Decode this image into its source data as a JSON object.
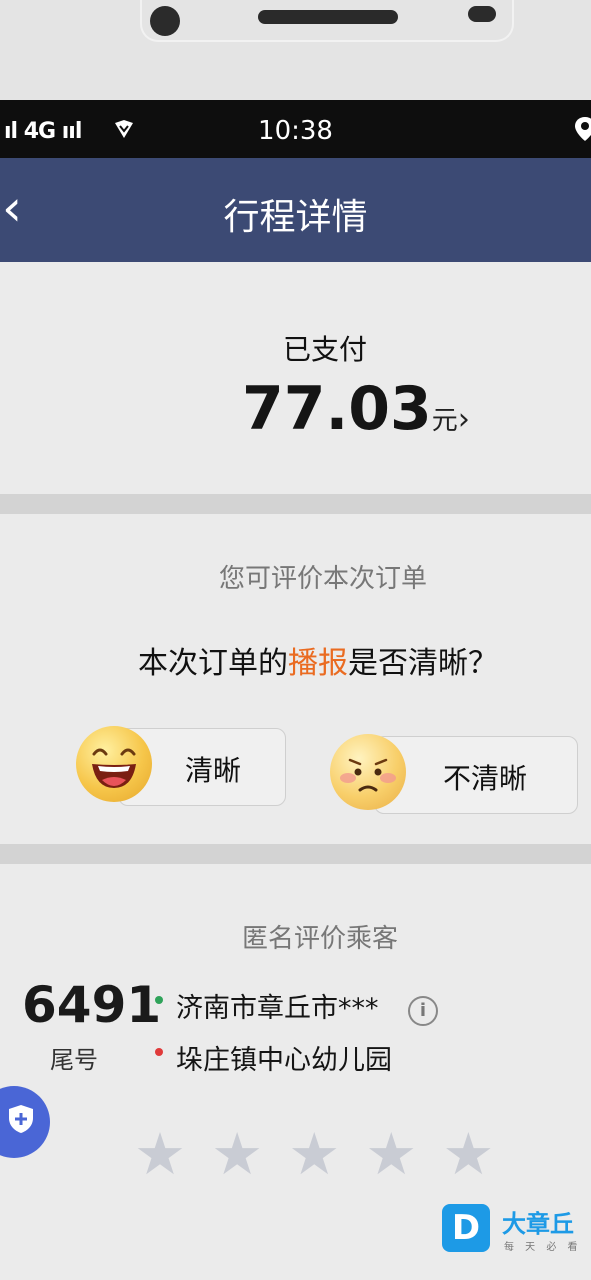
{
  "status_bar": {
    "signal": "ıl 4G ııl",
    "time": "10:38"
  },
  "header": {
    "back_glyph": "‹",
    "title": "行程详情"
  },
  "payment": {
    "status": "已支付",
    "amount": "77.03",
    "unit": "元",
    "detail_glyph": "›"
  },
  "rating": {
    "hint": "您可评价本次订单",
    "question_before": "本次订单的",
    "question_highlight": "播报",
    "question_after": "是否清晰？",
    "highlight_color": "#ea6b21",
    "options": [
      {
        "label": "清晰",
        "icon": "laughing-face-icon"
      },
      {
        "label": "不清晰",
        "icon": "sad-face-icon"
      }
    ]
  },
  "passenger": {
    "title": "匿名评价乘客",
    "tail_number": "6491",
    "tail_label": "尾号",
    "from": "济南市章丘市***",
    "to": "垛庄镇中心幼儿园",
    "stars_total": 5,
    "stars_selected": 0
  },
  "watermark": {
    "badge": "D",
    "name": "大章丘",
    "sub": "每 天 必 看"
  }
}
